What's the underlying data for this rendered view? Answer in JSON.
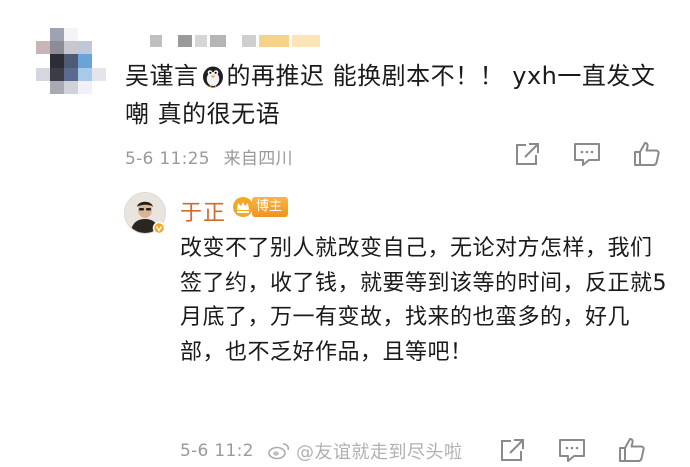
{
  "comment": {
    "text_before_emoji": "吴谨言",
    "emoji": "penguin-emoji",
    "text_after_emoji": "的再推迟 能换剧本不！！ yxh一直发文嘲 真的很无语",
    "timestamp": "5-6 11:25",
    "source": "来自四川"
  },
  "reply": {
    "author": "于正",
    "badge": "博主",
    "text": "改变不了别人就改变自己，无论对方怎样，我们签了约，收了钱，就要等到该等的时间，反正就5月底了，万一有变故，找来的也蛮多的，好几部，也不乏好作品，且等吧！",
    "timestamp": "5-6 11:2"
  },
  "watermark": {
    "text": "@友谊就走到尽头啦"
  },
  "icons": {
    "share": "share-icon",
    "comment": "comment-icon",
    "like": "like-icon"
  },
  "colors": {
    "author_name": "#d36a2c",
    "badge": "#ee9420",
    "meta_gray": "#9a9a9a"
  }
}
